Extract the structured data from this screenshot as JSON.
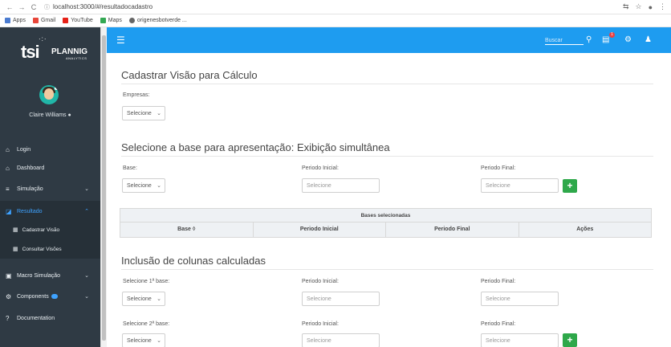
{
  "browser": {
    "url": "localhost:3000/#/resultadocadastro",
    "bookmarks": [
      "Apps",
      "Gmail",
      "YouTube",
      "Maps",
      "origenesbotverde ..."
    ]
  },
  "sidebar": {
    "logo_main": "tsi",
    "logo_sub": "PLANNIG",
    "logo_sub2": "ANALYTICS",
    "user_name": "Claire Williams",
    "items": [
      {
        "label": "Login",
        "icon": "home-icon"
      },
      {
        "label": "Dashboard",
        "icon": "home-icon"
      },
      {
        "label": "Simulação",
        "icon": "list-icon"
      },
      {
        "label": "Resultado",
        "icon": "chart-icon"
      },
      {
        "label": "Cadastrar Visão",
        "icon": "grid-icon"
      },
      {
        "label": "Consultar Visões",
        "icon": "grid-icon"
      },
      {
        "label": "Macro Simulação",
        "icon": "image-icon"
      },
      {
        "label": "Components",
        "icon": "gear-icon"
      },
      {
        "label": "Documentation",
        "icon": "question-icon"
      }
    ]
  },
  "topbar": {
    "search_placeholder": "Buscar",
    "notification_count": "1"
  },
  "main": {
    "title1": "Cadastrar Visão para Cálculo",
    "empresas_label": "Empresas:",
    "select_placeholder": "Selecione",
    "title2": "Selecione a base para apresentação: Exibição simultânea",
    "base_label": "Base:",
    "periodo_inicial_label": "Periodo Inicial:",
    "periodo_final_label": "Periodo Final:",
    "input_placeholder": "Selecione",
    "table_caption": "Bases selecionadas",
    "table_headers": [
      "Base ◊",
      "Periodo Inicial",
      "Periodo Final",
      "Ações"
    ],
    "title3": "Inclusão de colunas calculadas",
    "base1_label": "Selecione 1ª base:",
    "base2_label": "Selecione 2ª base:",
    "add_label": "+"
  }
}
